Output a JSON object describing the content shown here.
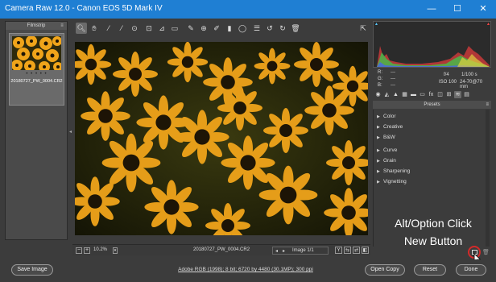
{
  "window": {
    "title": "Camera Raw 12.0  -  Canon EOS 5D Mark IV",
    "controls": [
      "—",
      "☐",
      "✕"
    ]
  },
  "filmstrip": {
    "header": "Filmstrip",
    "thumb_name": "20180727_PW_0004.CR2",
    "stars": "• • • • •"
  },
  "toolbar": {
    "tools": [
      "zoom-tool",
      "hand-tool",
      "white-balance-tool",
      "color-sampler-tool",
      "targeted-adjustment-tool",
      "crop-tool",
      "straighten-tool",
      "transform-tool",
      "spot-removal-tool",
      "red-eye-tool",
      "adjustment-brush-tool",
      "graduated-filter-tool",
      "radial-filter-tool",
      "preferences-tool",
      "rotate-left-tool",
      "rotate-right-tool",
      "trash-tool"
    ],
    "fullscreen": "fullscreen-toggle"
  },
  "status": {
    "zoom": "10.2%",
    "filename": "20180727_PW_0004.CR2",
    "image_counter": "Image 1/1"
  },
  "readout": {
    "r_label": "R:",
    "g_label": "G:",
    "b_label": "B:",
    "r_value": "---",
    "g_value": "---",
    "b_value": "---",
    "aperture": "f/4",
    "shutter": "1/100 s",
    "iso": "ISO 100",
    "lens": "24-70@70 mm"
  },
  "presets": {
    "header": "Presets",
    "groups": [
      "Color",
      "Creative",
      "B&W",
      "Curve",
      "Grain",
      "Sharpening",
      "Vignetting"
    ]
  },
  "overlay": {
    "line1": "Alt/Option Click",
    "line2": "New Button"
  },
  "bottom": {
    "save_image": "Save Image",
    "workflow": "Adobe RGB (1998); 8 bit; 6720 by 4480 (30.1MP); 300 ppi",
    "open_copy": "Open Copy",
    "reset": "Reset",
    "done": "Done"
  },
  "colors": {
    "titlebar": "#1f7fd3",
    "petal": "#f0a41a",
    "petal_dark": "#c97e08",
    "flower_center": "#1d1406",
    "highlight_circle": "#d42a2a"
  }
}
